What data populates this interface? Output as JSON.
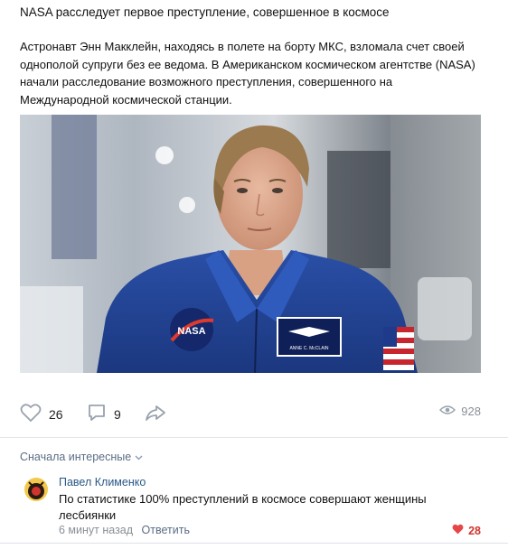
{
  "post": {
    "title": "NASA расследует первое преступление, совершенное в космосе",
    "text": "Астронавт Энн Макклейн, находясь в полете на борту МКС, взломала счет своей однополой супруги без ее ведома. В Американском космическом агентстве (NASA) начали расследование возможного преступления, совершенного на Международной космической станции.",
    "photo": {
      "patch_nasa": "NASA",
      "patch_name": "ANNE C. McCLAIN"
    }
  },
  "actions": {
    "likes": "26",
    "comments": "9",
    "views": "928",
    "icons": {
      "like": "heart-outline-icon",
      "comment": "speech-bubble-icon",
      "share": "share-arrow-icon",
      "views": "eye-icon"
    }
  },
  "comments": {
    "sort_label": "Сначала интересные",
    "items": [
      {
        "author": "Павел Клименко",
        "text": "По статистике 100% преступлений в космосе совершают женщины лесбиянки",
        "time": "6 минут назад",
        "reply_label": "Ответить",
        "likes": "28"
      }
    ]
  },
  "colors": {
    "link": "#2a5885",
    "like_red": "#d1362e",
    "muted": "#8a8f96"
  }
}
